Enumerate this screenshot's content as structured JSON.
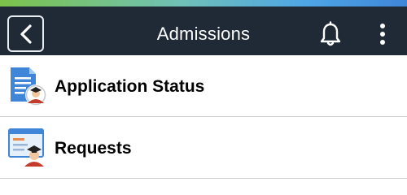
{
  "header": {
    "title": "Admissions",
    "back_icon": "chevron-left-icon",
    "bell_icon": "bell-icon",
    "menu_icon": "kebab-menu-icon",
    "background_color": "#1f2a36"
  },
  "list": {
    "items": [
      {
        "label": "Application Status",
        "icon": "application-status-icon"
      },
      {
        "label": "Requests",
        "icon": "requests-icon"
      }
    ]
  }
}
